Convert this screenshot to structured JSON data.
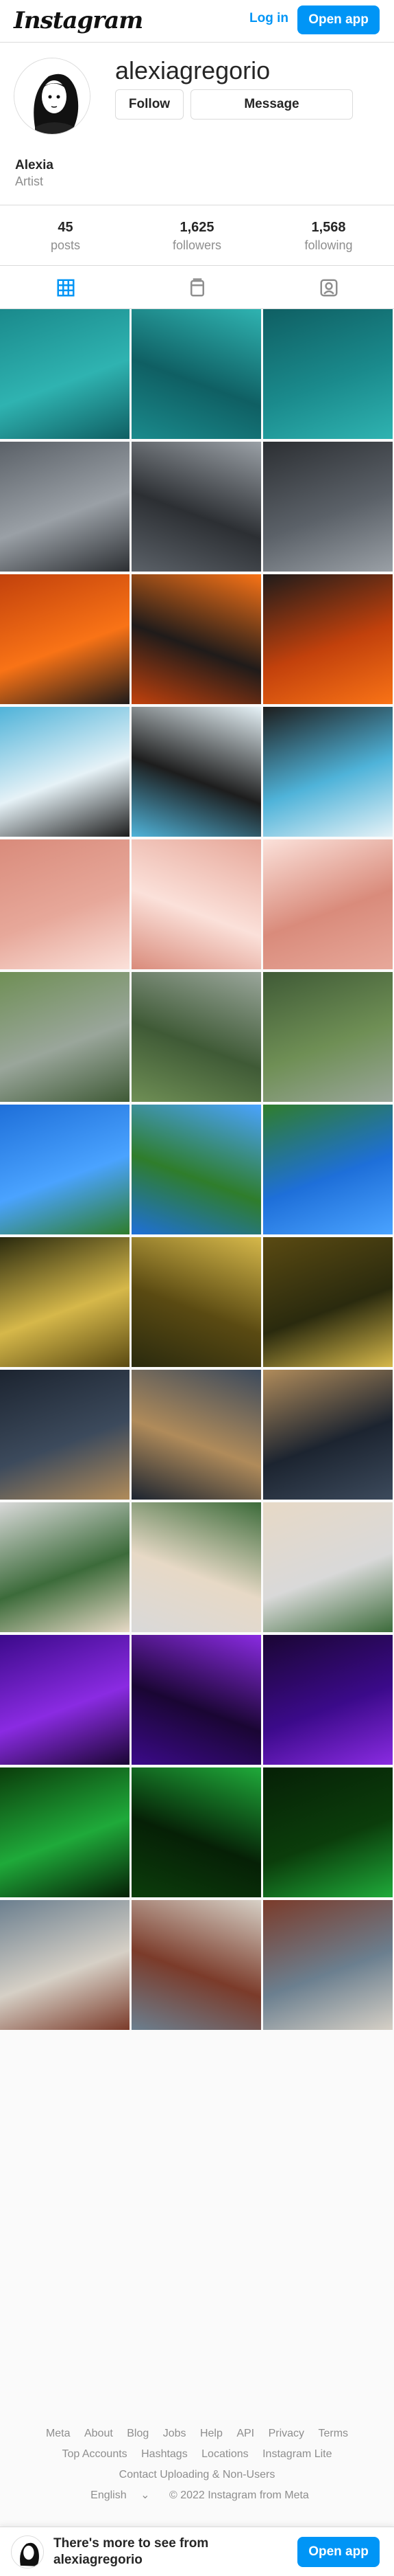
{
  "header": {
    "logo_text": "Instagram",
    "login_label": "Log in",
    "open_app_label": "Open app"
  },
  "profile": {
    "username": "alexiagregorio",
    "follow_label": "Follow",
    "message_label": "Message",
    "full_name": "Alexia",
    "bio": "Artist",
    "stats": [
      {
        "value": "45",
        "label": "posts"
      },
      {
        "value": "1,625",
        "label": "followers"
      },
      {
        "value": "1,568",
        "label": "following"
      }
    ]
  },
  "tabs": [
    {
      "name": "posts",
      "icon": "grid-icon",
      "active": true
    },
    {
      "name": "reels",
      "icon": "reels-icon",
      "active": false
    },
    {
      "name": "tagged",
      "icon": "tagged-icon",
      "active": false
    }
  ],
  "grid": {
    "rows": [
      {
        "theme": "pool",
        "colors": [
          "#1a8a8c",
          "#2fb3b1",
          "#0f5f63"
        ]
      },
      {
        "theme": "city",
        "colors": [
          "#5b6168",
          "#9aa0a6",
          "#2c2f33"
        ]
      },
      {
        "theme": "orange-room",
        "colors": [
          "#c2410c",
          "#f97316",
          "#1f1b1a"
        ]
      },
      {
        "theme": "car-window-sky",
        "colors": [
          "#4fb3d9",
          "#e6f2f7",
          "#1d1d1d"
        ]
      },
      {
        "theme": "pink-clouds",
        "colors": [
          "#d98b7b",
          "#e7a89a",
          "#fbe1da"
        ]
      },
      {
        "theme": "garden",
        "colors": [
          "#6f8f55",
          "#9aa69b",
          "#3f5a36"
        ]
      },
      {
        "theme": "park-sky",
        "colors": [
          "#1e6fd9",
          "#4aa3ff",
          "#2f7d2b"
        ]
      },
      {
        "theme": "fairy-lights",
        "colors": [
          "#2a2a0e",
          "#d6b84a",
          "#5a4a12"
        ]
      },
      {
        "theme": "night-city",
        "colors": [
          "#1c2430",
          "#3c4a5c",
          "#b08b5a"
        ]
      },
      {
        "theme": "plants-shelf",
        "colors": [
          "#d9d9d9",
          "#3c6b3a",
          "#e7d9c6"
        ]
      },
      {
        "theme": "purple-space",
        "colors": [
          "#3b0a8a",
          "#8a2be2",
          "#1a0633"
        ]
      },
      {
        "theme": "green-neon",
        "colors": [
          "#0b3d0b",
          "#1faa3a",
          "#062006"
        ]
      },
      {
        "theme": "cafe-street",
        "colors": [
          "#6b7f8f",
          "#d6d0c6",
          "#7b3b2a"
        ]
      }
    ]
  },
  "footer": {
    "links_row1": [
      "Meta",
      "About",
      "Blog",
      "Jobs",
      "Help",
      "API",
      "Privacy",
      "Terms"
    ],
    "links_row2": [
      "Top Accounts",
      "Hashtags",
      "Locations",
      "Instagram Lite"
    ],
    "links_row3": [
      "Contact Uploading & Non-Users"
    ],
    "language": "English",
    "copyright": "© 2022 Instagram from Meta"
  },
  "bottom_bar": {
    "text": "There's more to see from alexiagregorio",
    "open_app_label": "Open app"
  }
}
